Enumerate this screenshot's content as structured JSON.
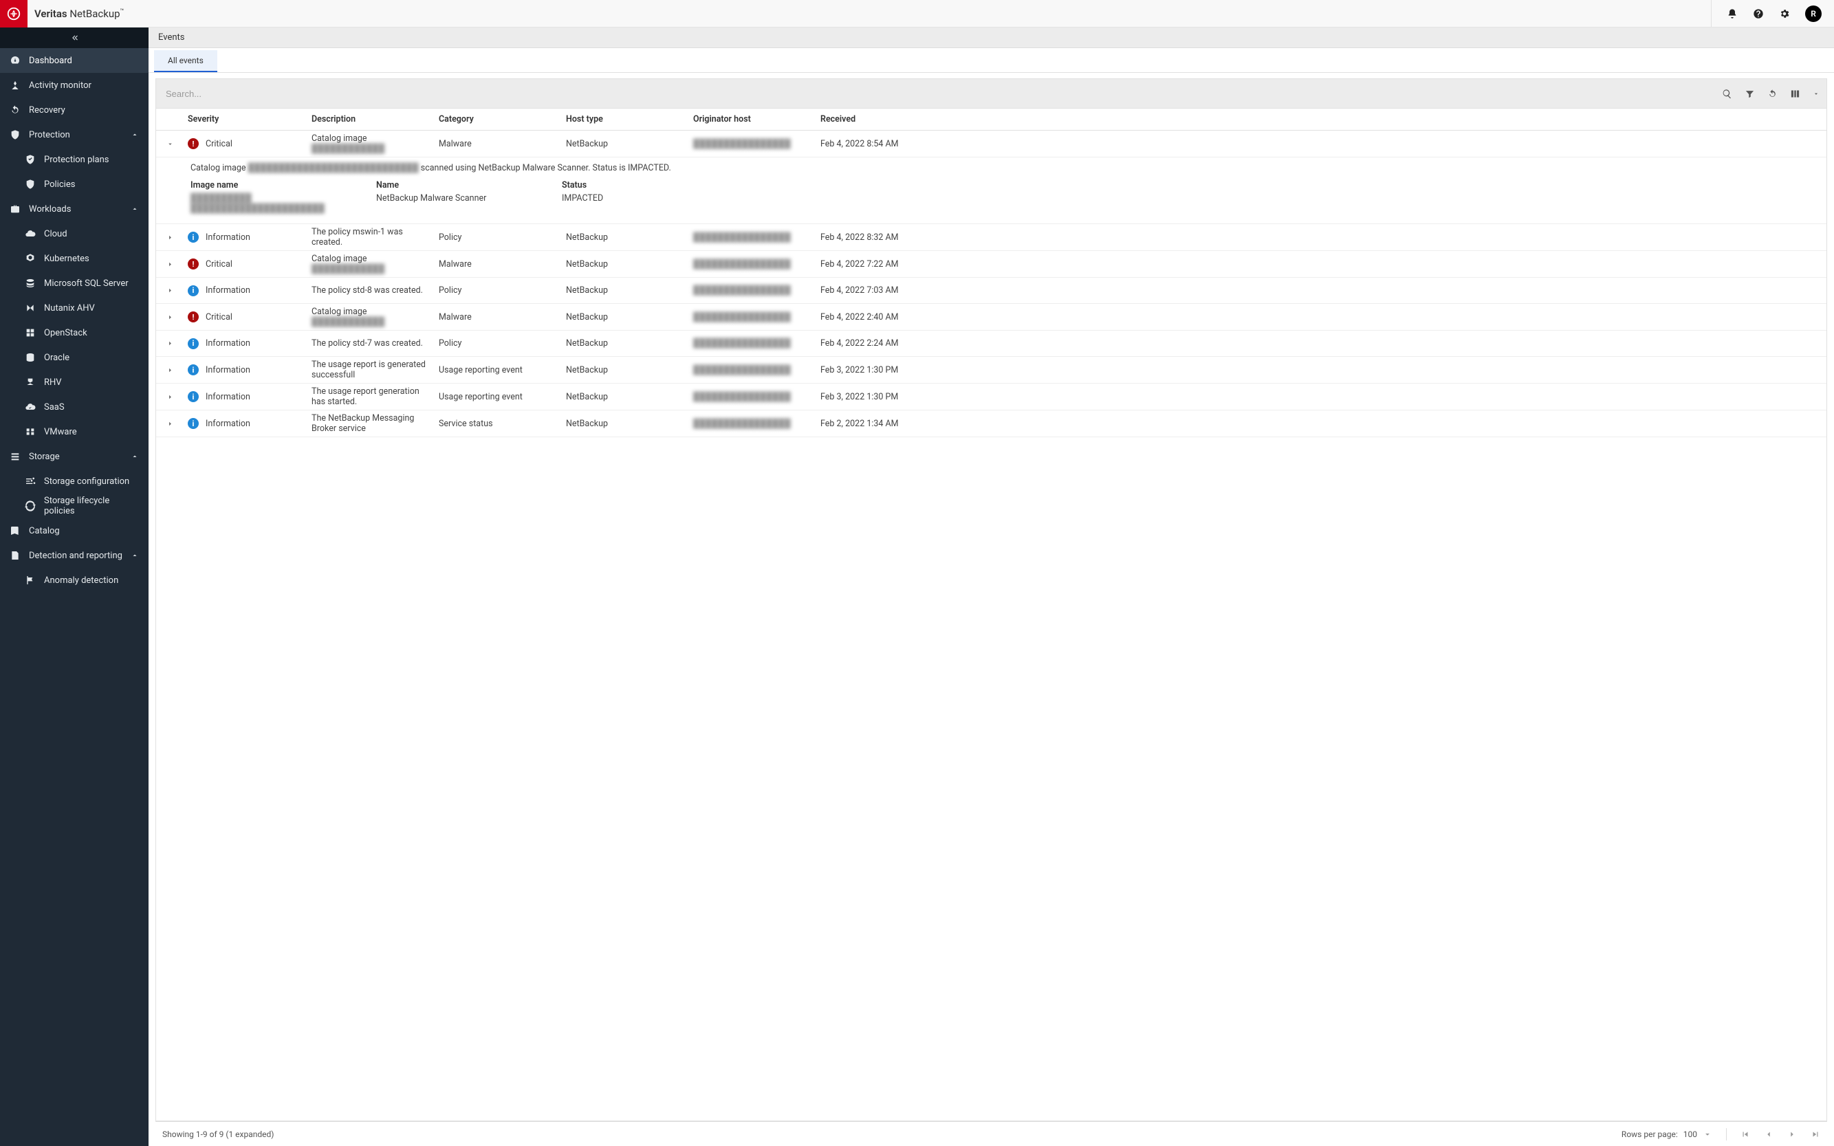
{
  "brand": {
    "strong": "Veritas",
    "light": " NetBackup",
    "tm": "™"
  },
  "avatar": "R",
  "sidebar": {
    "items": [
      {
        "icon": "gauge",
        "label": "Dashboard",
        "active": true
      },
      {
        "icon": "person",
        "label": "Activity monitor"
      },
      {
        "icon": "restore",
        "label": "Recovery"
      },
      {
        "icon": "shield",
        "label": "Protection",
        "expanded": true
      },
      {
        "icon": "briefcase",
        "label": "Workloads",
        "expanded": true
      },
      {
        "icon": "stack",
        "label": "Storage",
        "expanded": true
      },
      {
        "icon": "book",
        "label": "Catalog"
      },
      {
        "icon": "report",
        "label": "Detection and reporting",
        "expanded": true
      }
    ],
    "protection_children": [
      {
        "icon": "shield-check",
        "label": "Protection plans"
      },
      {
        "icon": "policy",
        "label": "Policies"
      }
    ],
    "workloads_children": [
      {
        "icon": "cloud",
        "label": "Cloud"
      },
      {
        "icon": "kube",
        "label": "Kubernetes"
      },
      {
        "icon": "mssql",
        "label": "Microsoft SQL Server"
      },
      {
        "icon": "nutanix",
        "label": "Nutanix AHV"
      },
      {
        "icon": "openstack",
        "label": "OpenStack"
      },
      {
        "icon": "oracle",
        "label": "Oracle"
      },
      {
        "icon": "rhv",
        "label": "RHV"
      },
      {
        "icon": "saas",
        "label": "SaaS"
      },
      {
        "icon": "vmware",
        "label": "VMware"
      }
    ],
    "storage_children": [
      {
        "icon": "tune",
        "label": "Storage configuration"
      },
      {
        "icon": "cycle",
        "label": "Storage lifecycle policies"
      }
    ],
    "detection_children": [
      {
        "icon": "flag",
        "label": "Anomaly detection"
      }
    ]
  },
  "page": {
    "title": "Events",
    "tab": "All events",
    "search_placeholder": "Search..."
  },
  "columns": [
    "Severity",
    "Description",
    "Category",
    "Host type",
    "Originator host",
    "Received"
  ],
  "rows": [
    {
      "expanded": true,
      "severity": "Critical",
      "description_prefix": "Catalog image ",
      "description_blur": "████████████",
      "category": "Malware",
      "host_type": "NetBackup",
      "originator_blur": "████████████████",
      "received": "Feb 4, 2022 8:54 AM"
    },
    {
      "severity": "Information",
      "description": "The policy mswin-1 was created.",
      "category": "Policy",
      "host_type": "NetBackup",
      "originator_blur": "████████████████",
      "received": "Feb 4, 2022 8:32 AM"
    },
    {
      "severity": "Critical",
      "description_prefix": "Catalog image ",
      "description_blur": "████████████",
      "category": "Malware",
      "host_type": "NetBackup",
      "originator_blur": "████████████████",
      "received": "Feb 4, 2022 7:22 AM"
    },
    {
      "severity": "Information",
      "description": "The policy std-8 was created.",
      "category": "Policy",
      "host_type": "NetBackup",
      "originator_blur": "████████████████",
      "received": "Feb 4, 2022 7:03 AM"
    },
    {
      "severity": "Critical",
      "description_prefix": "Catalog image ",
      "description_blur": "████████████",
      "category": "Malware",
      "host_type": "NetBackup",
      "originator_blur": "████████████████",
      "received": "Feb 4, 2022 2:40 AM"
    },
    {
      "severity": "Information",
      "description": "The policy std-7 was created.",
      "category": "Policy",
      "host_type": "NetBackup",
      "originator_blur": "████████████████",
      "received": "Feb 4, 2022 2:24 AM"
    },
    {
      "severity": "Information",
      "description": "The usage report is generated successfull",
      "category": "Usage reporting event",
      "host_type": "NetBackup",
      "originator_blur": "████████████████",
      "received": "Feb 3, 2022 1:30 PM"
    },
    {
      "severity": "Information",
      "description": "The usage report generation has started.",
      "category": "Usage reporting event",
      "host_type": "NetBackup",
      "originator_blur": "████████████████",
      "received": "Feb 3, 2022 1:30 PM"
    },
    {
      "severity": "Information",
      "description": "The NetBackup Messaging Broker service",
      "category": "Service status",
      "host_type": "NetBackup",
      "originator_blur": "████████████████",
      "received": "Feb 2, 2022 1:34 AM"
    }
  ],
  "row_detail": {
    "line_prefix": "Catalog image ",
    "line_blur1": "████████████████████████████",
    "line_mid": " scanned using NetBackup Malware Scanner. Status is IMPACTED.",
    "cols": {
      "image_name_label": "Image name",
      "image_name_blur": "██████████\n██████████████████████",
      "name_label": "Name",
      "name_value": "NetBackup Malware Scanner",
      "status_label": "Status",
      "status_value": "IMPACTED"
    }
  },
  "pager": {
    "showing": "Showing 1-9 of 9 (1 expanded)",
    "rows_per_page_label": "Rows per page:",
    "rows_per_page_value": "100"
  }
}
